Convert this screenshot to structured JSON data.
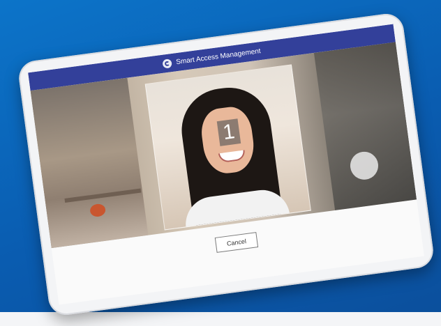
{
  "app": {
    "title": "Smart Access Management",
    "logo_icon": "logo-icon"
  },
  "camera": {
    "countdown": "1"
  },
  "actions": {
    "cancel_label": "Cancel"
  },
  "colors": {
    "header_bar": "#33409a",
    "background": "#0a5cb0"
  }
}
